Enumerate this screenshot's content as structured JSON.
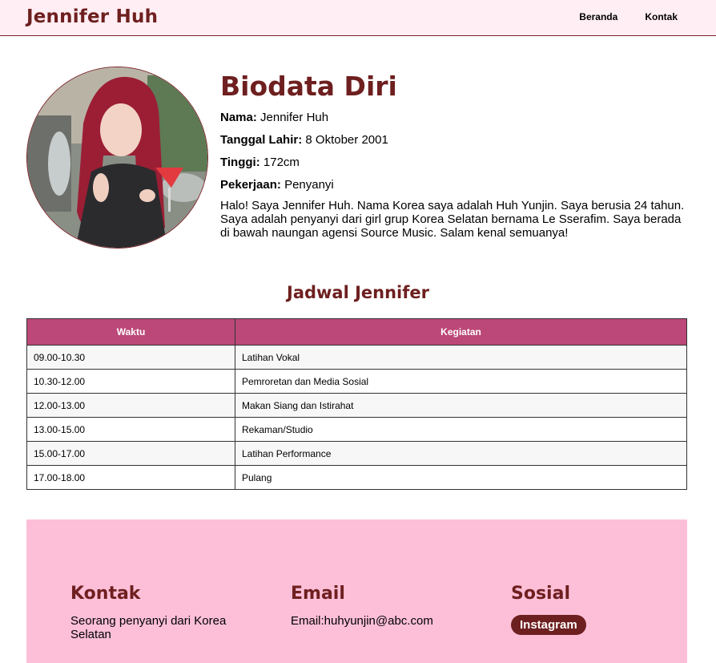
{
  "header": {
    "brand": "Jennifer Huh",
    "nav": [
      "Beranda",
      "Kontak"
    ]
  },
  "bio": {
    "title": "Biodata Diri",
    "fields": [
      {
        "label": "Nama:",
        "value": "Jennifer Huh"
      },
      {
        "label": "Tanggal Lahir:",
        "value": "8 Oktober 2001"
      },
      {
        "label": "Tinggi:",
        "value": "172cm"
      },
      {
        "label": "Pekerjaan:",
        "value": "Penyanyi"
      }
    ],
    "description": "Halo! Saya Jennifer Huh. Nama Korea saya adalah Huh Yunjin. Saya berusia 24 tahun. Saya adalah penyanyi dari girl grup Korea Selatan bernama Le Sserafim. Saya berada di bawah naungan agensi Source Music. Salam kenal semuanya!"
  },
  "schedule": {
    "title": "Jadwal Jennifer",
    "headers": [
      "Waktu",
      "Kegiatan"
    ],
    "rows": [
      [
        "09.00-10.30",
        "Latihan Vokal"
      ],
      [
        "10.30-12.00",
        "Pemroretan dan Media Sosial"
      ],
      [
        "12.00-13.00",
        "Makan Siang dan Istirahat"
      ],
      [
        "13.00-15.00",
        "Rekaman/Studio"
      ],
      [
        "15.00-17.00",
        "Latihan Performance"
      ],
      [
        "17.00-18.00",
        "Pulang"
      ]
    ]
  },
  "footer": {
    "kontak_title": "Kontak",
    "kontak_text": "Seorang penyanyi dari Korea Selatan",
    "email_title": "Email",
    "email_text": "Email:huhyunjin@abc.com",
    "sosial_title": "Sosial",
    "instagram_label": "Instagram"
  },
  "colors": {
    "header_bg": "#ffeef3",
    "accent_dark": "#6e1f1f",
    "table_header": "#bb4878",
    "footer_bg": "#fdbfd8"
  }
}
